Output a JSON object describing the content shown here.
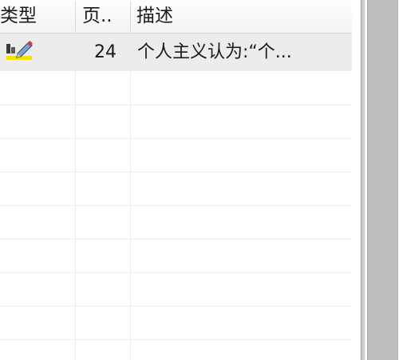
{
  "columns": {
    "type": "类型",
    "page": "页..",
    "description": "描述"
  },
  "rows": [
    {
      "type_icon": "pencil-note-icon",
      "page": "24",
      "description": "个人主义认为:“个..."
    }
  ],
  "colors": {
    "selected_row": "#ececec",
    "header_bg": "#f3f3f3",
    "side_pane": "#bdbdbd",
    "highlight": "#f2e400"
  }
}
